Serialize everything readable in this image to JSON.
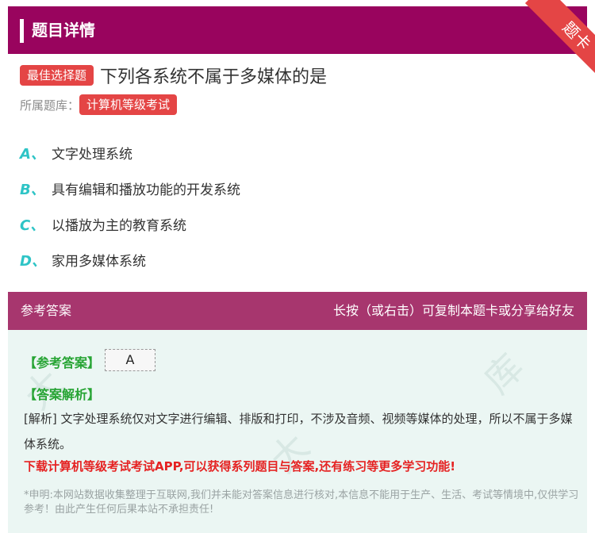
{
  "header": {
    "title": "题目详情",
    "corner_badge": "题卡"
  },
  "question": {
    "type_tag": "最佳选择题",
    "title": "下列各系统不属于多媒体的是",
    "bank_label": "所属题库：",
    "bank_name": "计算机等级考试"
  },
  "options": [
    {
      "letter": "A、",
      "text": "文字处理系统"
    },
    {
      "letter": "B、",
      "text": "具有编辑和播放功能的开发系统"
    },
    {
      "letter": "C、",
      "text": "以播放为主的教育系统"
    },
    {
      "letter": "D、",
      "text": "家用多媒体系统"
    }
  ],
  "answer": {
    "header_label": "参考答案",
    "header_hint": "长按（或右击）可复制本题卡或分享给好友",
    "answer_label": "【参考答案】",
    "answer_value": "A",
    "analysis_label": "【答案解析】",
    "analysis_text": "[解析] 文字处理系统仅对文字进行编辑、排版和打印，不涉及音频、视频等媒体的处理，所以不属于多媒体系统。",
    "promo_text": "下载计算机等级考试考试APP,可以获得系列题目与答案,还有练习等更多学习功能!",
    "disclaimer": "*申明:本网站数据收集整理于互联网,我们并未能对答案信息进行核对,本信息不能用于生产、生活、考试等情境中,仅供学习参考！由此产生任何后果本站不承担责任!"
  },
  "colors": {
    "header_bg": "#99045e",
    "answer_header_bg": "#a7366e",
    "tag_red": "#e44545",
    "option_letter": "#2ec4c6",
    "answer_green": "#27a434",
    "promo_red": "#e52222",
    "answer_bg": "#ebf6f3"
  }
}
